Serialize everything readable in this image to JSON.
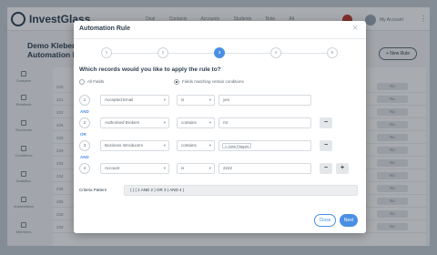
{
  "app": {
    "brand": "InvestGlass",
    "nav": [
      "Deal",
      "Contacts",
      "Accounts",
      "Students",
      "Note",
      "Alt"
    ],
    "account_label": "My Account",
    "page_title_line1": "Demo Kleber",
    "page_title_line2": "Automation Rule",
    "new_rule_label": "+ New Rule",
    "sidebar": [
      "Compare",
      "Relations",
      "Structures",
      "Conditions",
      "Analytics",
      "Automations",
      "Members"
    ],
    "bg_rows": [
      {
        "id": "220",
        "value": "No"
      },
      {
        "id": "221",
        "value": "No"
      },
      {
        "id": "222",
        "value": "No"
      },
      {
        "id": "225",
        "value": "No"
      },
      {
        "id": "228",
        "value": "No"
      },
      {
        "id": "229",
        "value": "No"
      },
      {
        "id": "233",
        "value": "No"
      },
      {
        "id": "234",
        "value": "No"
      },
      {
        "id": "235",
        "value": "No"
      },
      {
        "id": "236",
        "value": "No"
      },
      {
        "id": "238",
        "value": "No"
      },
      {
        "id": "239",
        "value": "No"
      }
    ]
  },
  "modal": {
    "title": "Automation Rule",
    "close_symbol": "×",
    "steps": [
      "1",
      "2",
      "3",
      "4",
      "5"
    ],
    "active_step": 3,
    "question": "Which records would you like to apply the rule to?",
    "options": {
      "all_fields": "All Fields",
      "matching": "Fields matching certain conditions",
      "selected": "matching"
    },
    "conditions": [
      {
        "num": "1",
        "field": "Accepted Email",
        "op": "is",
        "value": "yes",
        "chip": false
      },
      {
        "num": "2",
        "field": "Authorised Brokers",
        "op": "contains",
        "value": "rnr",
        "chip": false
      },
      {
        "num": "3",
        "field": "Business Introducers",
        "op": "contains",
        "value": "× John Pepper",
        "chip": true
      },
      {
        "num": "4",
        "field": "Account",
        "op": "is",
        "value": "2222",
        "chip": false
      }
    ],
    "connectors": [
      "AND",
      "OR",
      "AND"
    ],
    "remove_symbol": "−",
    "add_symbol": "+",
    "criteria_label": "Criteria Pattern",
    "criteria_value": "( ( ( 1 AND 2 ) OR 3 ) AND 4 )",
    "close_button": "Close",
    "next_button": "Next"
  }
}
